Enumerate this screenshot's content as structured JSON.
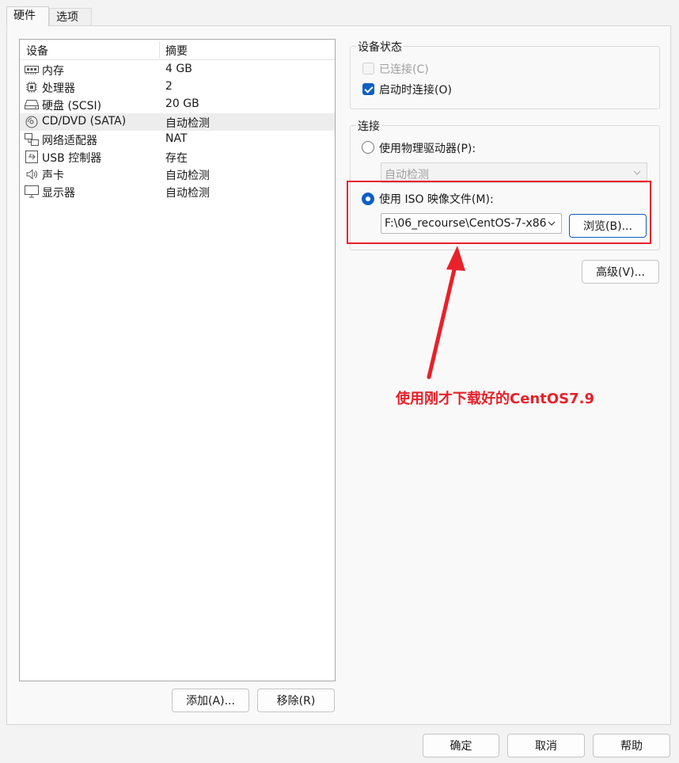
{
  "tabs": [
    {
      "label": "硬件",
      "active": true
    },
    {
      "label": "选项",
      "active": false
    }
  ],
  "device_list": {
    "headers": {
      "device": "设备",
      "summary": "摘要"
    },
    "rows": [
      {
        "icon": "memory-icon",
        "name": "内存",
        "summary": "4 GB",
        "selected": false
      },
      {
        "icon": "cpu-icon",
        "name": "处理器",
        "summary": "2",
        "selected": false
      },
      {
        "icon": "harddisk-icon",
        "name": "硬盘 (SCSI)",
        "summary": "20 GB",
        "selected": false
      },
      {
        "icon": "cd-dvd-icon",
        "name": "CD/DVD (SATA)",
        "summary": "自动检测",
        "selected": true
      },
      {
        "icon": "network-adapter-icon",
        "name": "网络适配器",
        "summary": "NAT",
        "selected": false
      },
      {
        "icon": "usb-icon",
        "name": "USB 控制器",
        "summary": "存在",
        "selected": false
      },
      {
        "icon": "sound-card-icon",
        "name": "声卡",
        "summary": "自动检测",
        "selected": false
      },
      {
        "icon": "display-icon",
        "name": "显示器",
        "summary": "自动检测",
        "selected": false
      }
    ]
  },
  "list_buttons": {
    "add": "添加(A)...",
    "remove": "移除(R)"
  },
  "device_status": {
    "title": "设备状态",
    "connected": {
      "label": "已连接(C)",
      "checked": false,
      "enabled": false
    },
    "connect_at_power_on": {
      "label": "启动时连接(O)",
      "checked": true,
      "enabled": true
    }
  },
  "connection": {
    "title": "连接",
    "physical_drive": {
      "label": "使用物理驱动器(P):",
      "selected": false,
      "value": "自动检测"
    },
    "iso_image": {
      "label": "使用 ISO 映像文件(M):",
      "selected": true,
      "path": "F:\\06_recourse\\CentOS-7-x86_",
      "browse": "浏览(B)..."
    }
  },
  "advanced_button": "高级(V)...",
  "annotation": "使用刚才下载好的CentOS7.9",
  "footer": {
    "ok": "确定",
    "cancel": "取消",
    "help": "帮助"
  },
  "colors": {
    "accent": "#0f5fc2",
    "annotation_red": "#e8212a"
  }
}
